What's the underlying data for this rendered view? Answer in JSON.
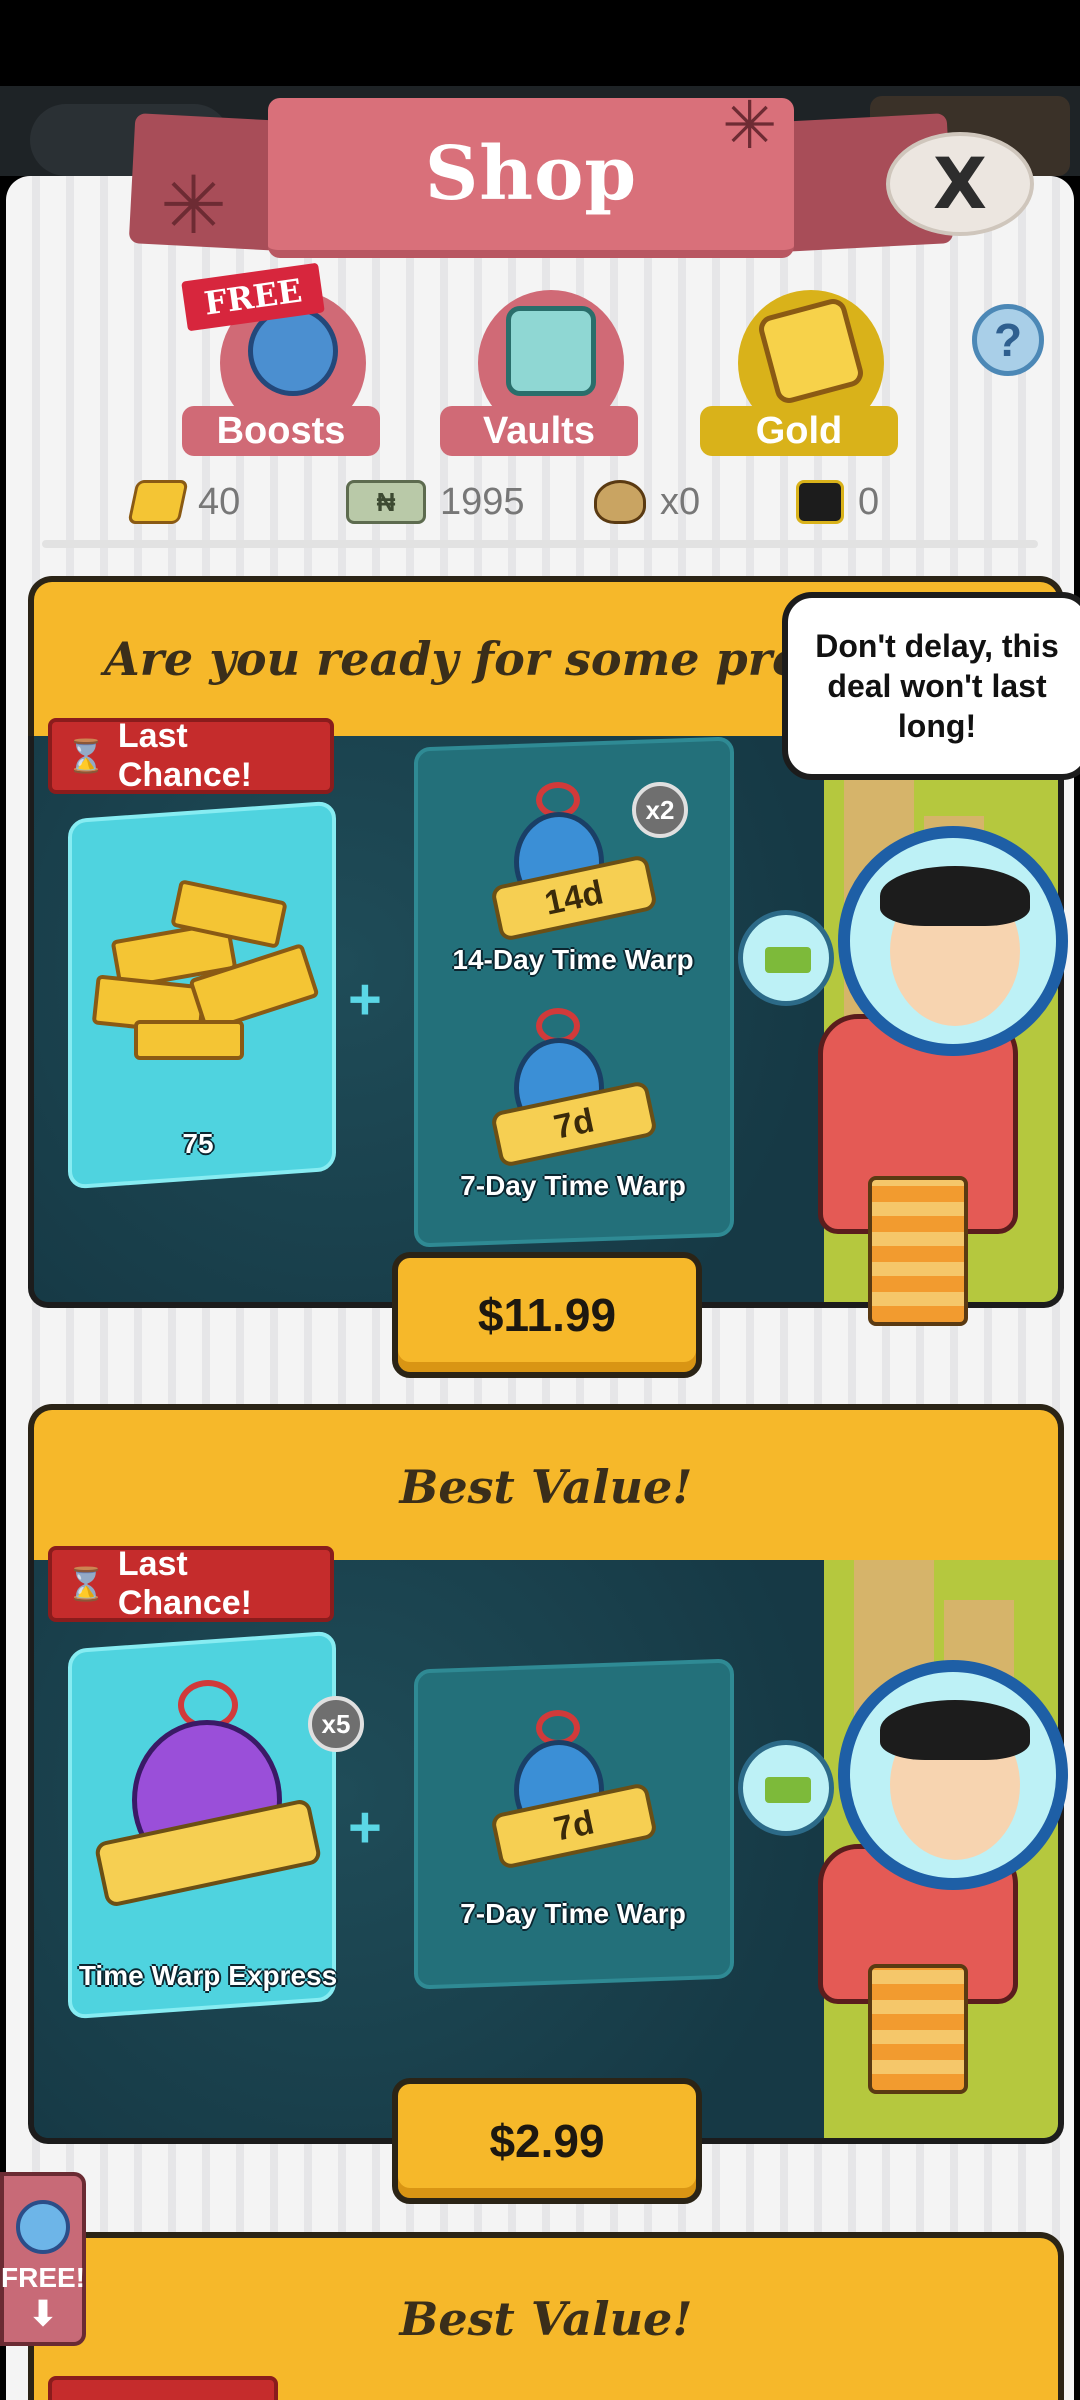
{
  "header": {
    "title": "Shop",
    "close_label": "X"
  },
  "tabs": [
    {
      "label": "Boosts",
      "badge": "FREE",
      "color": "#d06a76",
      "icon": "stopwatch-boost-icon"
    },
    {
      "label": "Vaults",
      "color": "#d06a76",
      "icon": "vault-icon"
    },
    {
      "label": "Gold",
      "color": "#d9b21a",
      "icon": "gold-bar-icon",
      "selected": true
    }
  ],
  "help_label": "?",
  "currencies": [
    {
      "icon": "gold-icon",
      "value": "40"
    },
    {
      "icon": "cash-icon",
      "value": "1995"
    },
    {
      "icon": "money-bag-icon",
      "value": "x0"
    },
    {
      "icon": "token-icon",
      "value": "0"
    }
  ],
  "offers": [
    {
      "header": "Are you ready for some profits?!",
      "tag": "Last Chance!",
      "main_item": {
        "caption": "75",
        "icon": "gold-bars-icon"
      },
      "extras": [
        {
          "caption": "14-Day Time Warp",
          "ribbon": "14d",
          "multiplier": "x2",
          "icon": "time-warp-icon"
        },
        {
          "caption": "7-Day Time Warp",
          "ribbon": "7d",
          "icon": "time-warp-icon"
        }
      ],
      "speech": "Don't delay, this deal won't last long!",
      "price": "$11.99"
    },
    {
      "header": "Best Value!",
      "tag": "Last Chance!",
      "main_item": {
        "caption": "Time Warp Express",
        "multiplier": "x5",
        "icon": "time-warp-express-icon"
      },
      "extras": [
        {
          "caption": "7-Day Time Warp",
          "ribbon": "7d",
          "icon": "time-warp-icon"
        }
      ],
      "price": "$2.99"
    },
    {
      "header": "Best Value!"
    }
  ],
  "side_button": {
    "label": "FREE!",
    "arrow": "⬇"
  },
  "icons": {
    "cash_mark": "₦"
  }
}
